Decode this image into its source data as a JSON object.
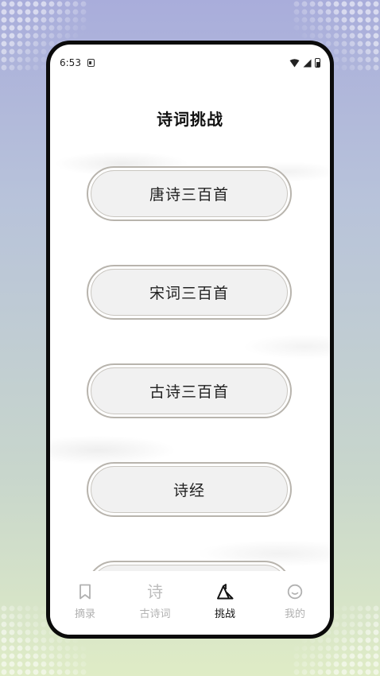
{
  "status_bar": {
    "time": "6:53"
  },
  "page": {
    "title": "诗词挑战"
  },
  "challenge_list": [
    {
      "label": "唐诗三百首"
    },
    {
      "label": "宋词三百首"
    },
    {
      "label": "古诗三百首"
    },
    {
      "label": "诗经"
    },
    {
      "label": ""
    }
  ],
  "tab_bar": {
    "active_index": 2,
    "tabs": [
      {
        "label": "摘录",
        "icon": "bookmark-icon"
      },
      {
        "label": "古诗词",
        "icon": "shi-character-icon",
        "glyph": "诗"
      },
      {
        "label": "挑战",
        "icon": "mountain-flag-icon"
      },
      {
        "label": "我的",
        "icon": "smiley-face-icon"
      }
    ]
  },
  "colors": {
    "active_tab": "#111111",
    "inactive_tab": "#b1b1b1",
    "button_border": "#b8b4ad",
    "button_fill": "#f1f1f1"
  }
}
